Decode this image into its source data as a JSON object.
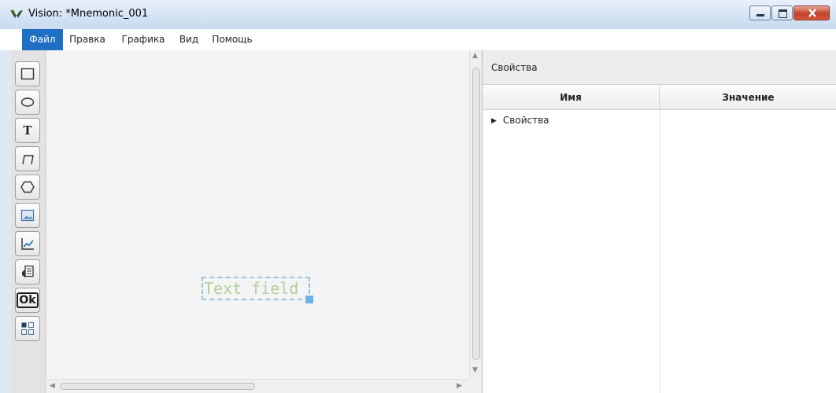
{
  "window": {
    "title": "Vision: *Mnemonic_001",
    "controls": {
      "minimize": "minimize-icon",
      "maximize": "maximize-icon",
      "close": "close-icon"
    }
  },
  "menu": {
    "items": [
      {
        "label": "Файл",
        "active": true
      },
      {
        "label": "Правка"
      },
      {
        "label": "Графика"
      },
      {
        "label": "Вид"
      },
      {
        "label": "Помощь"
      }
    ]
  },
  "toolbox": {
    "tools": [
      {
        "icon": "rectangle-icon"
      },
      {
        "icon": "ellipse-icon"
      },
      {
        "icon": "text-icon",
        "glyph": "T"
      },
      {
        "icon": "polyline-icon"
      },
      {
        "icon": "polygon-icon"
      },
      {
        "icon": "image-icon"
      },
      {
        "icon": "trend-chart-icon"
      },
      {
        "icon": "document-icon"
      },
      {
        "icon": "button-icon",
        "glyph": "Ok"
      },
      {
        "icon": "widget-grid-icon"
      }
    ]
  },
  "canvas": {
    "element": {
      "text": "Text field",
      "selected": true
    }
  },
  "properties": {
    "title": "Свойства",
    "columns": {
      "name": "Имя",
      "value": "Значение"
    },
    "tree": [
      {
        "label": "Свойства",
        "expanded": false
      }
    ]
  },
  "colors": {
    "menu_active": "#1f6fc5",
    "selection": "#6fb3e6",
    "text_field": "#b3cf9a"
  }
}
